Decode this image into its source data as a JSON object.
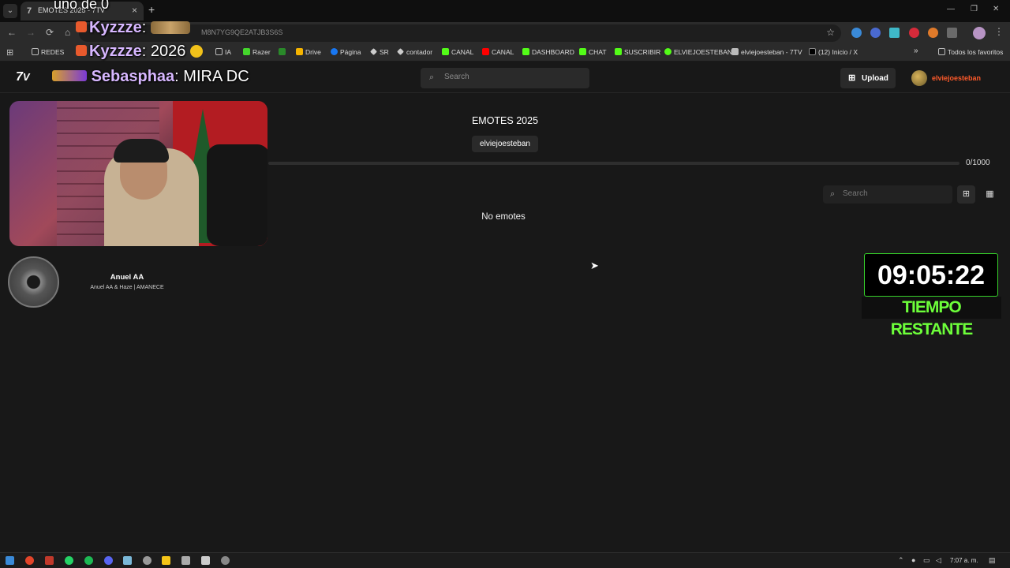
{
  "browser": {
    "tab_title": "EMOTES 2025 - 7TV",
    "tab_favicon": "7",
    "url_visible": "M8N7YG9QE2ATJB3S6S",
    "bookmarks": [
      "REDES",
      "IA",
      "Razer",
      "Drive",
      "Página",
      "SR",
      "contador",
      "CANAL",
      "CANAL",
      "DASHBOARD",
      "CHAT",
      "SUSCRIBIR",
      "ELVIEJOESTEBAN",
      "elviejoesteban - 7TV",
      "(12) Inicio / X"
    ],
    "all_bookmarks": "Todos los favoritos"
  },
  "stream_overlay": {
    "top_line": "uno de 0",
    "chat": [
      {
        "name": "Kyzzze",
        "text": ""
      },
      {
        "name": "Kyzzze",
        "text": "2026"
      },
      {
        "name": "Sebasphaa",
        "text": "MIRA DC"
      }
    ],
    "music": {
      "title": "Anuel AA",
      "subtitle": "Anuel AA & Haze | AMANECE"
    },
    "timer": {
      "value": "09:05:22",
      "label": "TIEMPO RESTANTE"
    }
  },
  "site": {
    "search_placeholder": "Search",
    "upload_label": "Upload",
    "username": "elviejoesteban",
    "set_title": "EMOTES 2025",
    "owner": "elviejoesteban",
    "capacity": "0/1000",
    "capacity_fraction": 0,
    "emote_search_placeholder": "Search",
    "empty_message": "No emotes"
  },
  "taskbar": {
    "clock": "7:07 a. m."
  },
  "colors": {
    "accent_username": "#ff5a2a",
    "timer_border": "#36d12a",
    "timer_label": "#6dff3a",
    "chat_name": "#d7b7ff"
  }
}
